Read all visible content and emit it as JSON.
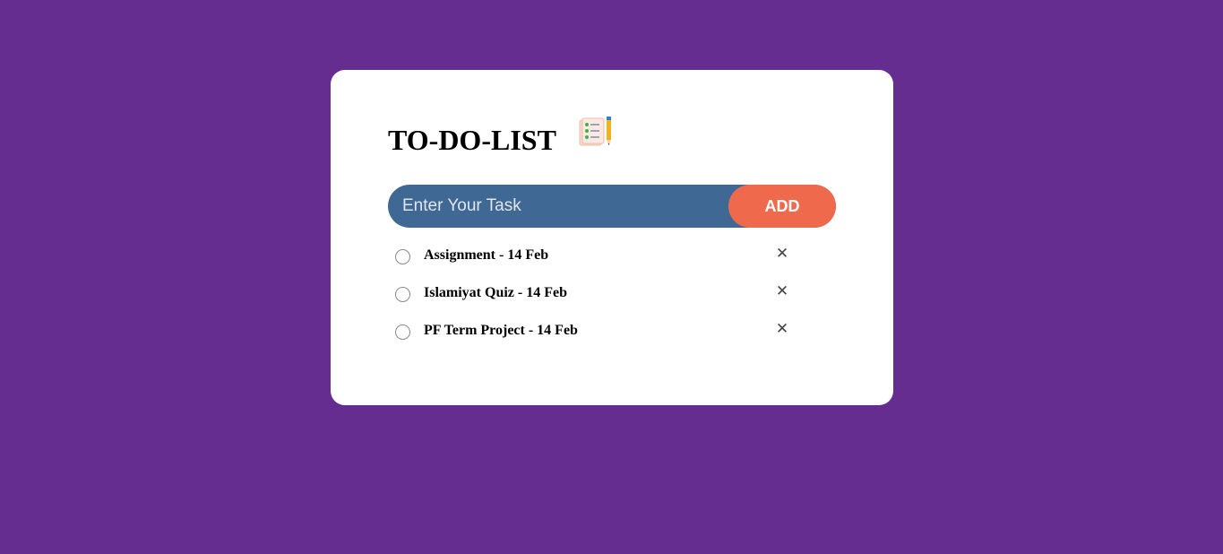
{
  "app": {
    "title": "TO-DO-LIST",
    "title_icon": "notepad-pencil-icon"
  },
  "input": {
    "placeholder": "Enter Your Task",
    "value": ""
  },
  "add_button": {
    "label": "ADD"
  },
  "tasks": [
    {
      "text": "Assignment - 14 Feb",
      "checked": false,
      "remove_icon": "close-icon"
    },
    {
      "text": "Islamiyat Quiz - 14 Feb",
      "checked": false,
      "remove_icon": "close-icon"
    },
    {
      "text": "PF Term Project - 14 Feb",
      "checked": false,
      "remove_icon": "close-icon"
    }
  ],
  "colors": {
    "background": "#662d91",
    "card": "#ffffff",
    "input_bg": "#3f6894",
    "button_bg": "#ef6a4d",
    "button_text": "#ffffff"
  }
}
